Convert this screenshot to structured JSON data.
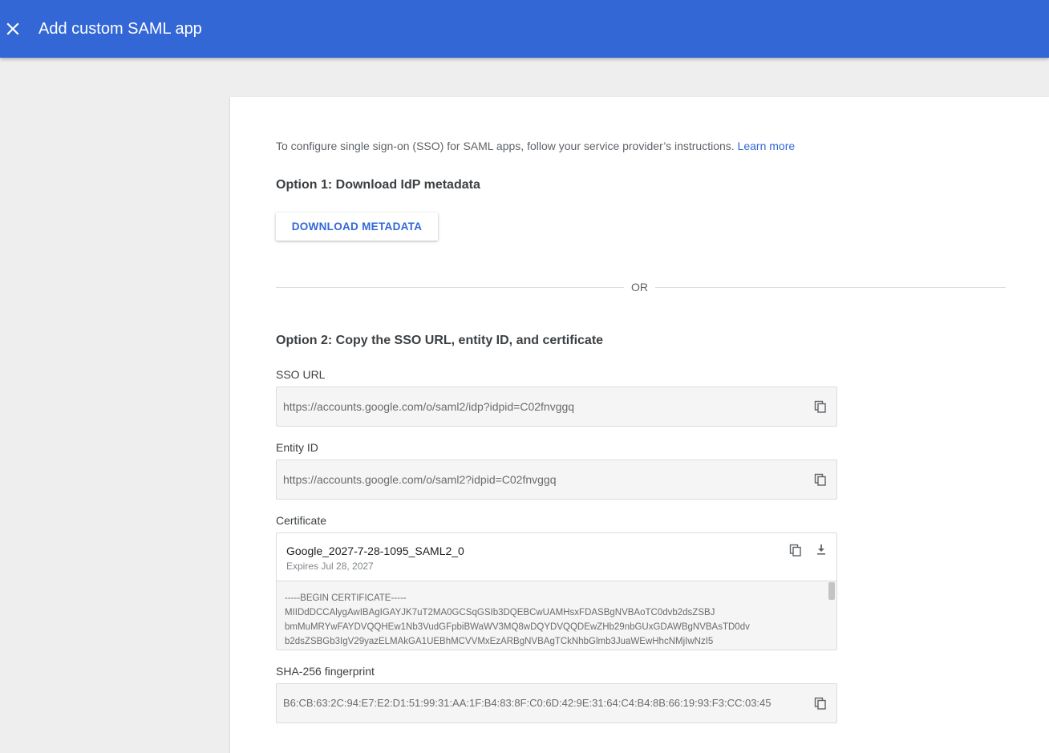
{
  "header": {
    "close_icon": "close-icon",
    "title": "Add custom SAML app",
    "background": "#3367d6"
  },
  "intro": {
    "text": "To configure single sign-on (SSO) for SAML apps, follow your service provider’s instructions.",
    "link": "Learn more"
  },
  "option1": {
    "heading": "Option 1: Download IdP metadata",
    "button": "DOWNLOAD METADATA"
  },
  "divider": {
    "label": "OR"
  },
  "option2": {
    "heading": "Option 2: Copy the SSO URL, entity ID, and certificate",
    "sso_url": {
      "label": "SSO URL",
      "value": "https://accounts.google.com/o/saml2/idp?idpid=C02fnvggq"
    },
    "entity_id": {
      "label": "Entity ID",
      "value": "https://accounts.google.com/o/saml2?idpid=C02fnvggq"
    },
    "certificate": {
      "label": "Certificate",
      "name": "Google_2027-7-28-1095_SAML2_0",
      "expires": "Expires Jul 28, 2027",
      "lines": [
        "-----BEGIN CERTIFICATE-----",
        "MIIDdDCCAlygAwIBAgIGAYJK7uT2MA0GCSqGSIb3DQEBCwUAMHsxFDASBgNVBAoTC0dvb2dsZSBJ",
        "bmMuMRYwFAYDVQQHEw1Nb3VudGFpbiBWaWV3MQ8wDQYDVQQDEwZHb29nbGUxGDAWBgNVBAsTD0dv",
        "b2dsZSBGb3IgV29yazELMAkGA1UEBhMCVVMxEzARBgNVBAgTCkNhbGlmb3JuaWEwHhcNMjIwNzI5"
      ]
    },
    "fingerprint": {
      "label": "SHA-256 fingerprint",
      "value": "B6:CB:63:2C:94:E7:E2:D1:51:99:31:AA:1F:B4:83:8F:C0:6D:42:9E:31:64:C4:B4:8B:66:19:93:F3:CC:03:45"
    }
  },
  "colors": {
    "accent": "#3367d6",
    "page_background": "#eeeeee",
    "field_background": "#f5f5f5"
  }
}
